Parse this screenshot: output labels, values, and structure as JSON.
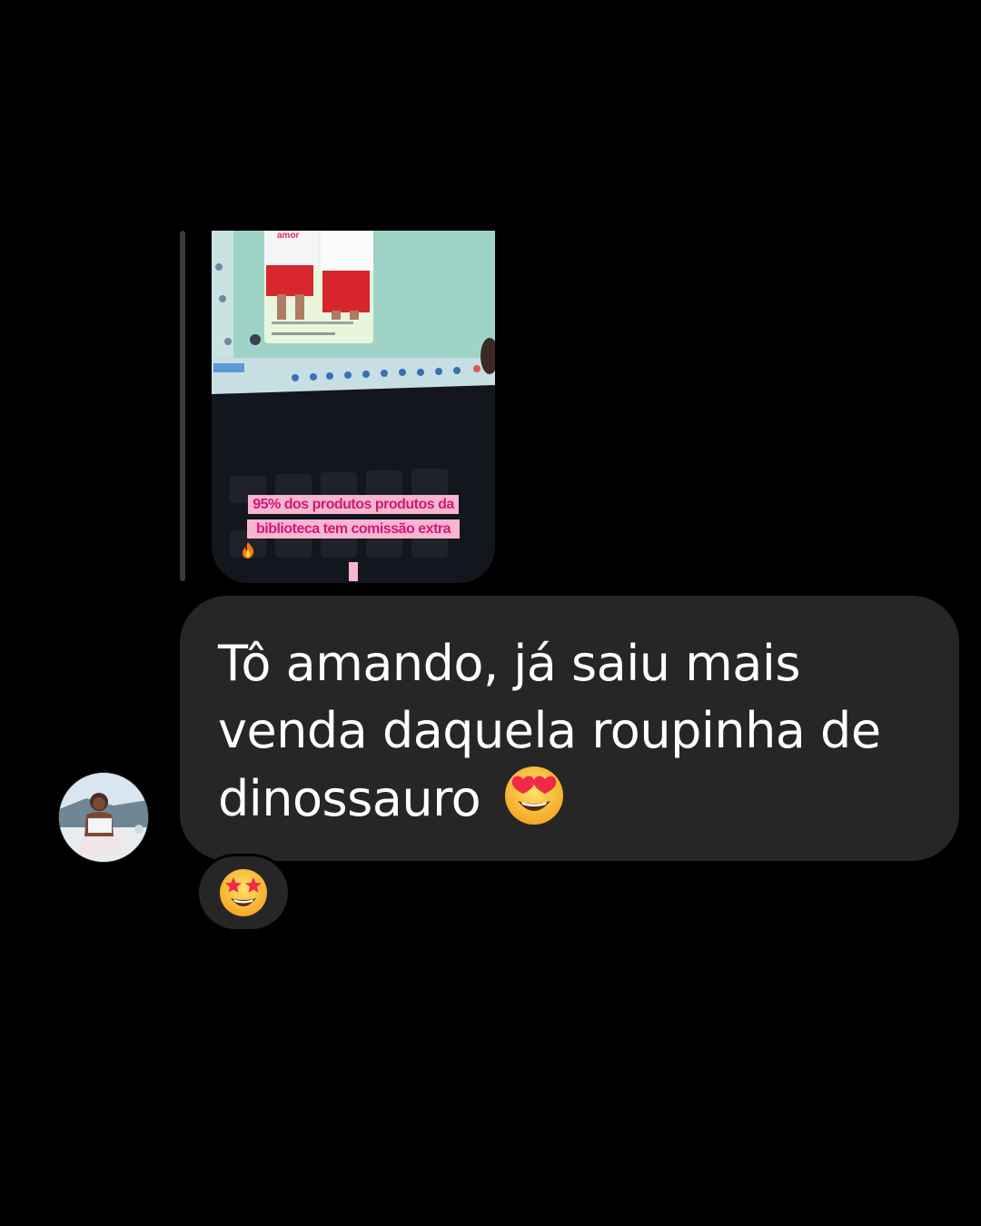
{
  "story_reply": {
    "caption_line1": "95% dos produtos produtos da",
    "caption_line2": "biblioteca tem comissão extra",
    "caption_emoji": "fire-icon",
    "shirt_text": "amor"
  },
  "message": {
    "text": "Tô amando, já saiu mais venda daquela roupinha de dinossauro",
    "emoji": "heart-eyes-emoji"
  },
  "reaction": {
    "emoji": "star-struck-emoji"
  },
  "colors": {
    "background": "#000000",
    "bubble": "#262626",
    "text": "#ffffff",
    "caption_bg": "#f7b6cf",
    "caption_text": "#d1177a"
  }
}
